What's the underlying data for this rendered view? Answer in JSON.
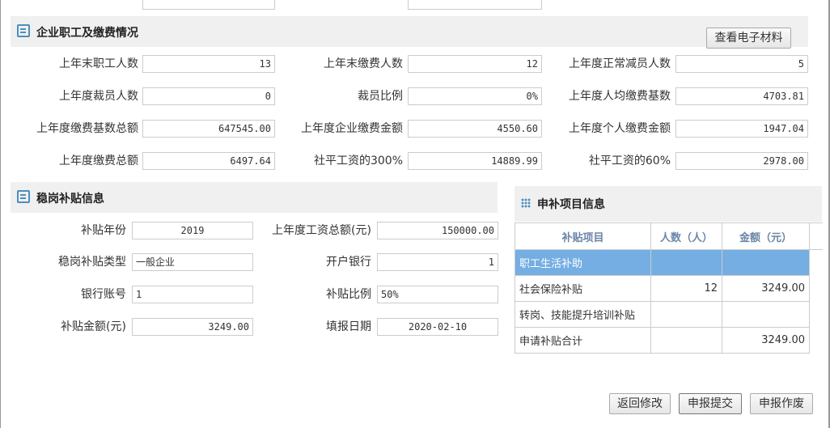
{
  "section1": {
    "title": "企业职工及缴费情况",
    "view_button": "查看电子材料",
    "fields": [
      {
        "label": "上年末职工人数",
        "value": "13"
      },
      {
        "label": "上年末缴费人数",
        "value": "12"
      },
      {
        "label": "上年度正常减员人数",
        "value": "5"
      },
      {
        "label": "上年度裁员人数",
        "value": "0"
      },
      {
        "label": "裁员比例",
        "value": "0%"
      },
      {
        "label": "上年度人均缴费基数",
        "value": "4703.81"
      },
      {
        "label": "上年度缴费基数总额",
        "value": "647545.00"
      },
      {
        "label": "上年度企业缴费金额",
        "value": "4550.60"
      },
      {
        "label": "上年度个人缴费金额",
        "value": "1947.04"
      },
      {
        "label": "上年度缴费总额",
        "value": "6497.64"
      },
      {
        "label": "社平工资的300%",
        "value": "14889.99"
      },
      {
        "label": "社平工资的60%",
        "value": "2978.00"
      }
    ]
  },
  "section2": {
    "title": "稳岗补贴信息",
    "fields": [
      {
        "label": "补贴年份",
        "value": "2019"
      },
      {
        "label": "上年度工资总额(元)",
        "value": "150000.00"
      },
      {
        "label": "稳岗补贴类型",
        "value": "一般企业"
      },
      {
        "label": "开户银行",
        "value": "1"
      },
      {
        "label": "银行账号",
        "value": "1"
      },
      {
        "label": "补贴比例",
        "value": "50%"
      },
      {
        "label": "补贴金额(元)",
        "value": "3249.00"
      },
      {
        "label": "填报日期",
        "value": "2020-02-10"
      }
    ]
  },
  "panel": {
    "title": "申补项目信息",
    "headers": [
      "补贴项目",
      "人数（人）",
      "金额（元）"
    ],
    "rows": [
      [
        "职工生活补助",
        "",
        ""
      ],
      [
        "社会保险补贴",
        "12",
        "3249.00"
      ],
      [
        "转岗、技能提升培训补贴",
        "",
        ""
      ],
      [
        "申请补贴合计",
        "",
        "3249.00"
      ]
    ]
  },
  "buttons": {
    "back": "返回修改",
    "submit": "申报提交",
    "void": "申报作废"
  }
}
